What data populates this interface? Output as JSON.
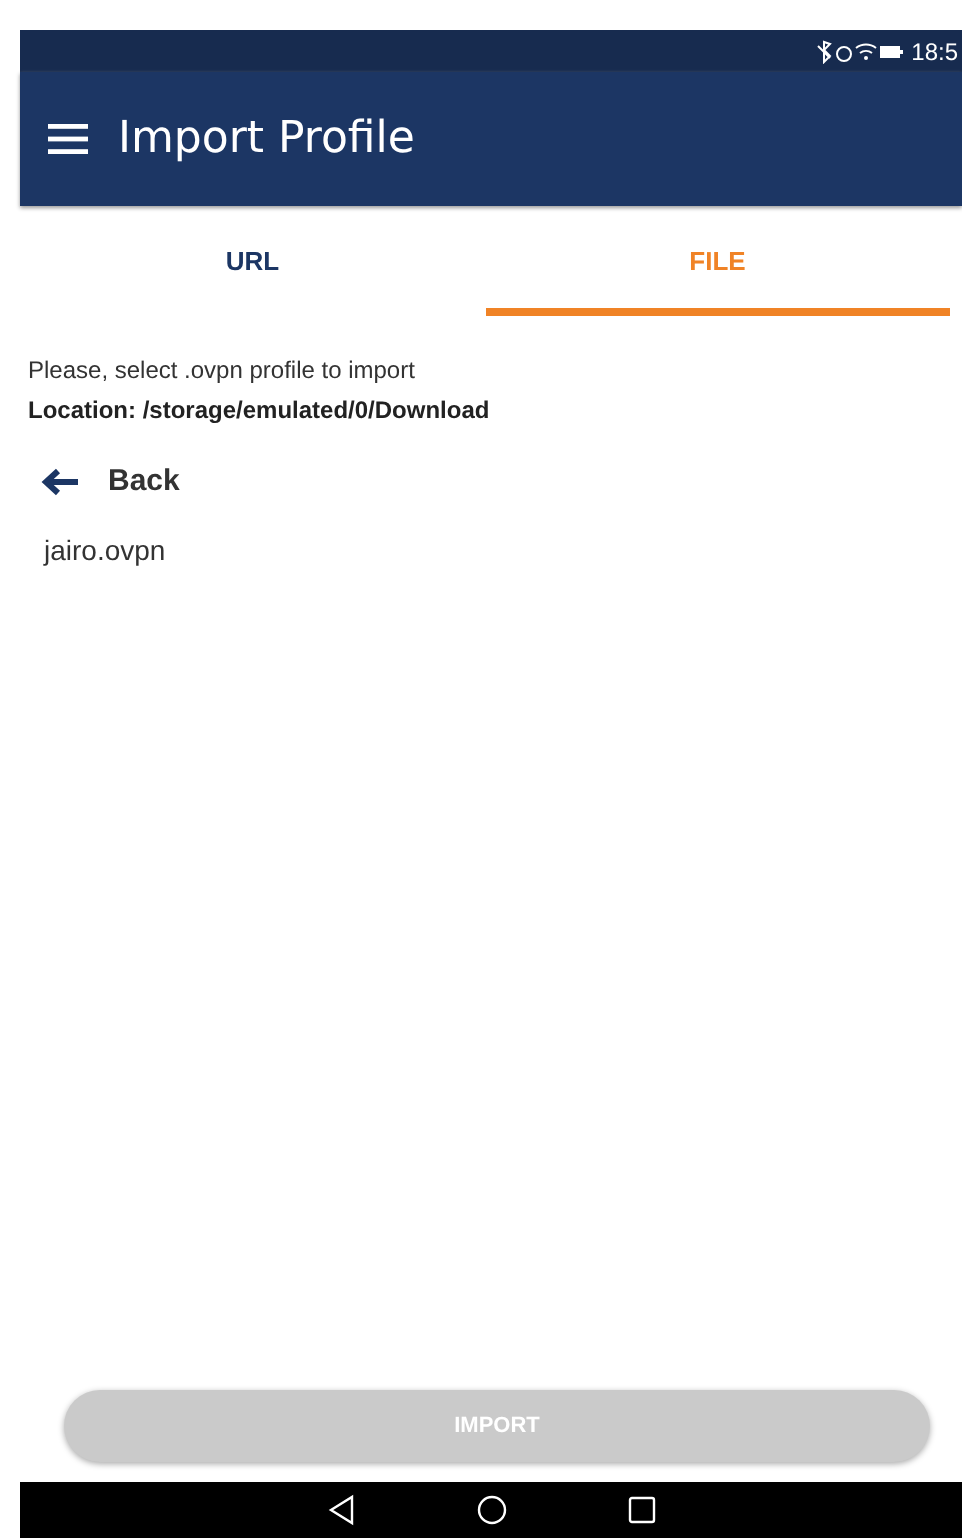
{
  "status_bar": {
    "time": "18:5"
  },
  "app_bar": {
    "title": "Import Profile"
  },
  "tabs": [
    {
      "label": "URL",
      "selected": false
    },
    {
      "label": "FILE",
      "selected": true
    }
  ],
  "instruction": "Please, select .ovpn profile to import",
  "location": "Location: /storage/emulated/0/Download",
  "back": {
    "label": "Back"
  },
  "files": [
    {
      "name": "jairo.ovpn"
    }
  ],
  "import_button": {
    "label": "IMPORT",
    "disabled": true
  }
}
